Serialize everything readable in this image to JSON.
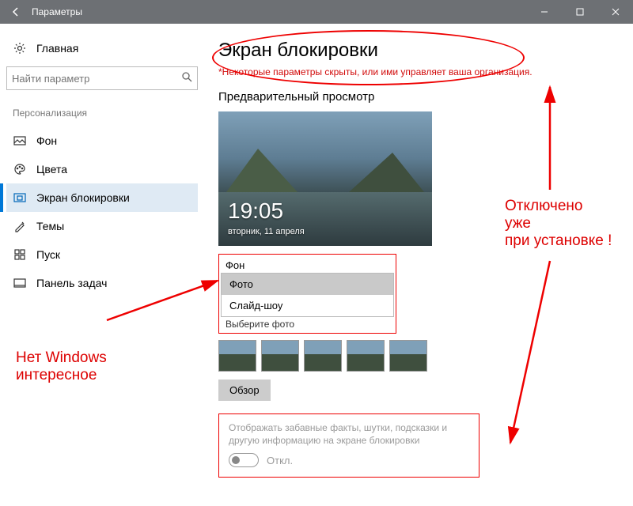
{
  "window": {
    "title": "Параметры"
  },
  "sidebar": {
    "home": "Главная",
    "search_placeholder": "Найти параметр",
    "section": "Персонализация",
    "items": [
      {
        "label": "Фон"
      },
      {
        "label": "Цвета"
      },
      {
        "label": "Экран блокировки"
      },
      {
        "label": "Темы"
      },
      {
        "label": "Пуск"
      },
      {
        "label": "Панель задач"
      }
    ]
  },
  "main": {
    "title": "Экран блокировки",
    "warning": "*Некоторые параметры скрыты, или ими управляет ваша организация.",
    "preview_label": "Предварительный просмотр",
    "preview_time": "19:05",
    "preview_date": "вторник, 11 апреля",
    "bg_label": "Фон",
    "bg_options": {
      "photo": "Фото",
      "slideshow": "Слайд-шоу"
    },
    "choose_photo": "Выберите фото",
    "browse": "Обзор",
    "info_desc": "Отображать забавные факты, шутки, подсказки и другую информацию на экране блокировки",
    "toggle_state": "Откл."
  },
  "annotations": {
    "left": "Нет Windows\nинтересное",
    "right": "Отключено\nуже\nпри установке !"
  }
}
